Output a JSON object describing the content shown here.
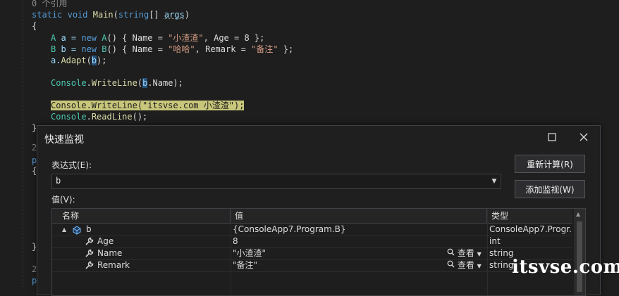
{
  "editor": {
    "ref_count": "0 个引用",
    "lines": {
      "l1_kw1": "static",
      "l1_kw2": "void",
      "l1_fn": "Main",
      "l1_rest1": "(",
      "l1_kw3": "string",
      "l1_rest2": "[] ",
      "l1_prm": "args",
      "l1_rest3": ")",
      "brace_open": "{",
      "l3_ty": "A",
      "l3_var": " a = ",
      "l3_kw": "new",
      "l3_ty2": " A",
      "l3_rest1": "() { Name = ",
      "l3_str1": "\"小渣渣\"",
      "l3_rest2": ", Age = 8 };",
      "l4_ty": "B",
      "l4_var": " b = ",
      "l4_kw": "new",
      "l4_ty2": " B",
      "l4_rest1": "() { Name = ",
      "l4_str1": "\"哈哈\"",
      "l4_rest2": ", Remark = ",
      "l4_str2": "\"备注\"",
      "l4_rest3": " };",
      "l5_a": "a.",
      "l5_fn": "Adapt",
      "l5_open": "(",
      "l5_b": "b",
      "l5_close": ");",
      "l7_ty": "Console",
      "l7_dot": ".",
      "l7_fn": "WriteLine",
      "l7_open": "(",
      "l7_b": "b",
      "l7_rest": ".Name);",
      "l9_full": "Console.WriteLine(\"itsvse.com 小渣渣\");",
      "l10_ty": "Console",
      "l10_dot": ".",
      "l10_fn": "ReadLine",
      "l10_rest": "();",
      "brace_close": "}",
      "left_2a": "2",
      "left_p1": "p",
      "left_brace": "{",
      "left_close": "}",
      "left_2b": "2",
      "left_p2": "p"
    }
  },
  "dialog": {
    "title": "快速监视",
    "maximize_icon": "maximize-icon",
    "close_icon": "close-icon",
    "expression_label": "表达式(E):",
    "expression_value": "b",
    "value_label": "值(V):",
    "recalculate_button": "重新计算(R)",
    "add_watch_button": "添加监视(W)",
    "columns": [
      "名称",
      "值",
      "类型"
    ],
    "rows": [
      {
        "name": "b",
        "value": "{ConsoleApp7.Program.B}",
        "type": "ConsoleApp7.Progr...",
        "icon": "object-icon",
        "expander": "▲",
        "view": ""
      },
      {
        "name": "Age",
        "value": "8",
        "type": "int",
        "icon": "wrench-icon",
        "expander": "",
        "view": ""
      },
      {
        "name": "Name",
        "value": "\"小渣渣\"",
        "type": "string",
        "icon": "wrench-icon",
        "expander": "",
        "view": "查看"
      },
      {
        "name": "Remark",
        "value": "\"备注\"",
        "type": "string",
        "icon": "wrench-icon",
        "expander": "",
        "view": "查看"
      }
    ]
  },
  "watermark": "itsvse.com"
}
